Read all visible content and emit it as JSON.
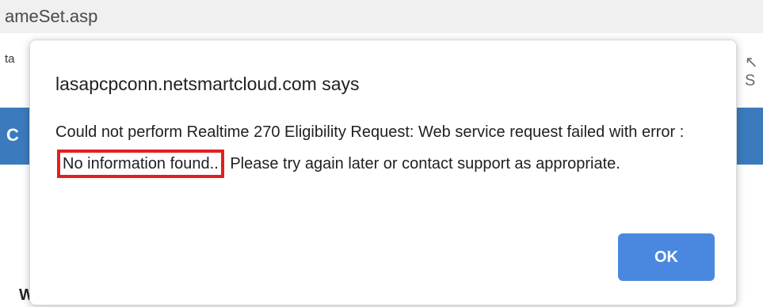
{
  "browser": {
    "address_fragment": "ameSet.asp"
  },
  "page": {
    "text_fragment": "ta",
    "header_letter": "C",
    "right_glyph": "↖ S",
    "bottom_letter": "W"
  },
  "dialog": {
    "title": "lasapcpconn.netsmartcloud.com says",
    "message_part1": "Could not perform Realtime 270 Eligibility Request: Web service request failed with error :",
    "message_highlight": "No information found..",
    "message_part2": "Please try again later or contact support as appropriate.",
    "ok_label": "OK"
  },
  "colors": {
    "ok_button": "#4a88e0",
    "highlight_border": "#e02020",
    "page_header": "#3b7bbd"
  }
}
